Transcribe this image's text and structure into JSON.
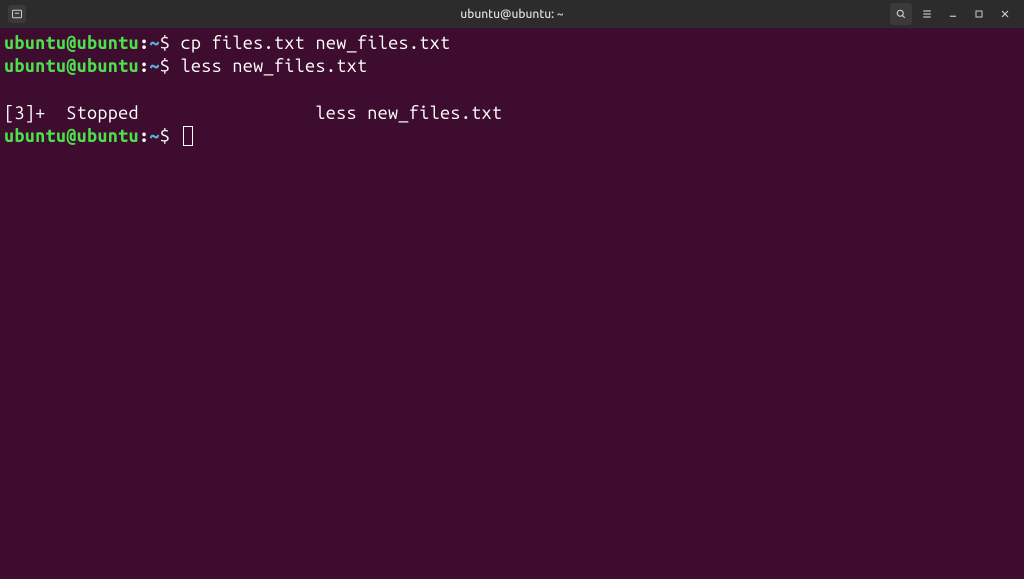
{
  "titlebar": {
    "title": "ubuntu@ubuntu: ~"
  },
  "prompt": {
    "user_host": "ubuntu@ubuntu",
    "colon": ":",
    "path": "~",
    "symbol": "$ "
  },
  "lines": {
    "cmd1": "cp files.txt new_files.txt",
    "cmd2": "less new_files.txt",
    "job_output": "[3]+  Stopped                 less new_files.txt"
  }
}
